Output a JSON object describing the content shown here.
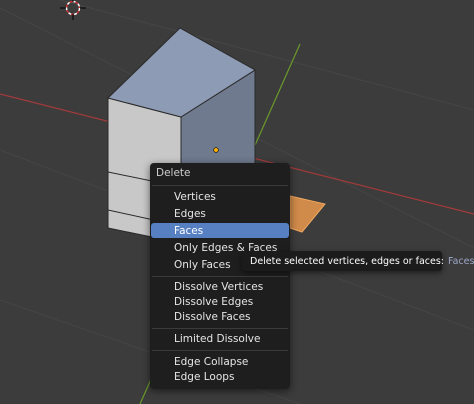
{
  "menu": {
    "title": "Delete",
    "items": [
      {
        "label": "Vertices",
        "active": false
      },
      {
        "label": "Edges",
        "active": false
      },
      {
        "label": "Faces",
        "active": true
      },
      {
        "label": "Only Edges & Faces",
        "active": false
      },
      {
        "label": "Only Faces",
        "active": false
      },
      {
        "label": "Dissolve Vertices",
        "active": false
      },
      {
        "label": "Dissolve Edges",
        "active": false
      },
      {
        "label": "Dissolve Faces",
        "active": false
      },
      {
        "label": "Limited Dissolve",
        "active": false
      },
      {
        "label": "Edge Collapse",
        "active": false
      },
      {
        "label": "Edge Loops",
        "active": false
      }
    ]
  },
  "tooltip": {
    "text": "Delete selected vertices, edges or faces:",
    "operator": "Faces"
  },
  "colors": {
    "background": "#3c3c3c",
    "menu_bg": "#1e1e1e",
    "highlight": "#5680c2",
    "x_axis": "#a33a3a",
    "y_axis": "#6a9a2a",
    "selected_face": "#d08a4a"
  }
}
